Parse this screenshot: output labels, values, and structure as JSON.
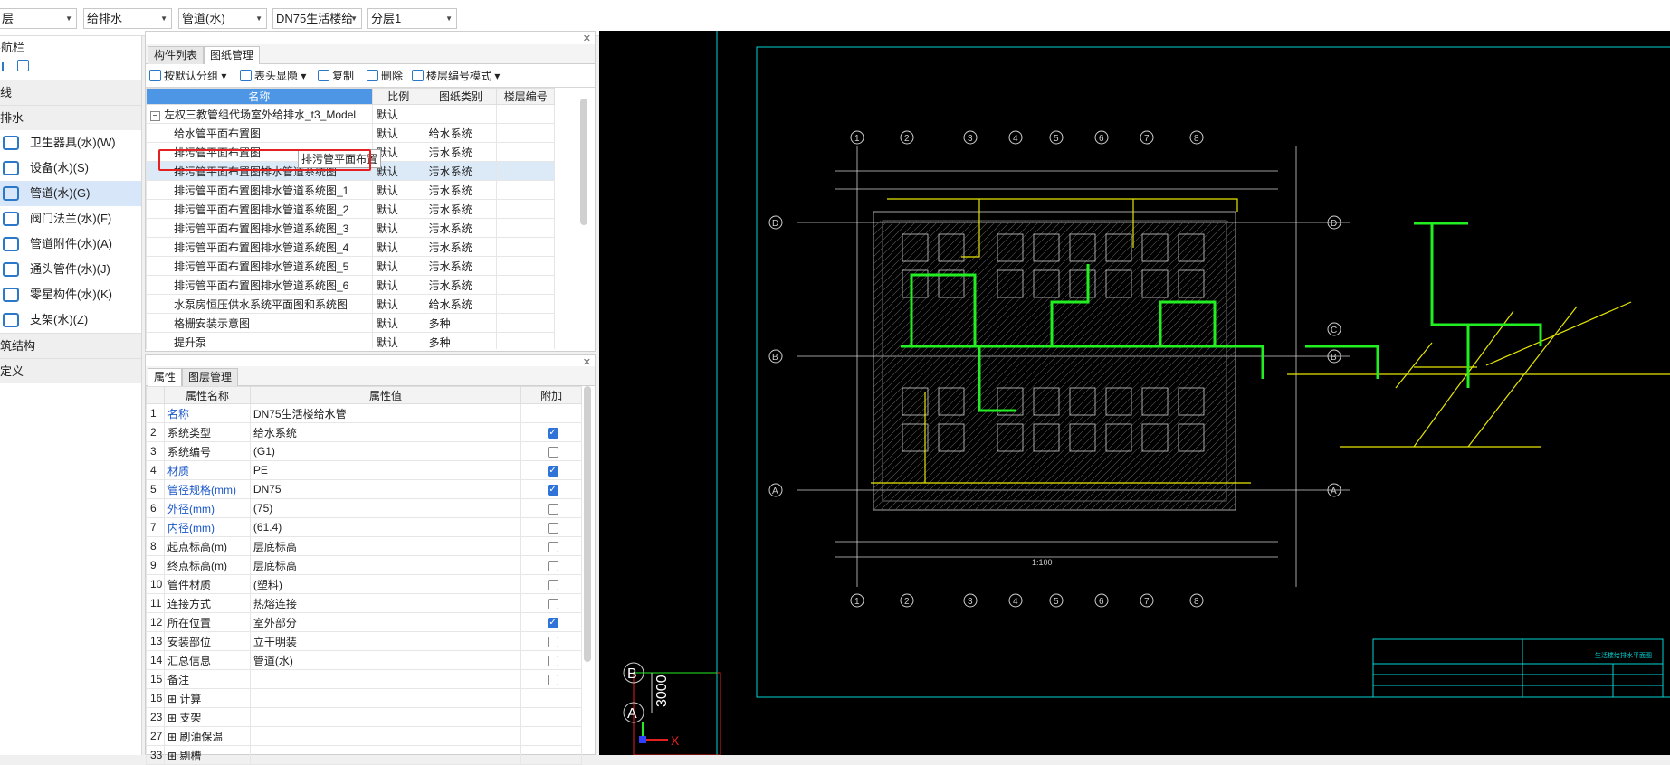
{
  "topbar": {
    "combos": [
      {
        "label": "层"
      },
      {
        "label": "给排水"
      },
      {
        "label": "管道(水)"
      },
      {
        "label": "DN75生活楼给"
      },
      {
        "label": "分层1"
      }
    ]
  },
  "nav": {
    "title": "导航栏",
    "categories": [
      {
        "label": "线"
      },
      {
        "label": "排水"
      }
    ],
    "items": [
      {
        "label": "卫生器具(水)(W)",
        "icon": "sanitary-icon"
      },
      {
        "label": "设备(水)(S)",
        "icon": "equipment-icon"
      },
      {
        "label": "管道(水)(G)",
        "icon": "pipe-icon"
      },
      {
        "label": "阀门法兰(水)(F)",
        "icon": "valve-icon"
      },
      {
        "label": "管道附件(水)(A)",
        "icon": "pipe-accessory-icon"
      },
      {
        "label": "通头管件(水)(J)",
        "icon": "fitting-icon"
      },
      {
        "label": "零星构件(水)(K)",
        "icon": "misc-component-icon"
      },
      {
        "label": "支架(水)(Z)",
        "icon": "support-icon"
      }
    ],
    "bottom_categories": [
      {
        "label": "筑结构"
      },
      {
        "label": "定义"
      }
    ]
  },
  "drawing_panel": {
    "tabs": [
      "构件列表",
      "图纸管理"
    ],
    "active_tab": "图纸管理",
    "toolbar": {
      "group": "按默认分组",
      "header_display": "表头显隐",
      "copy": "复制",
      "delete": "删除",
      "floor_mode": "楼层编号模式"
    },
    "columns": [
      "名称",
      "比例",
      "图纸类别",
      "楼层编号"
    ],
    "parent_row": {
      "name": "左权三教管组代场室外给排水_t3_Model",
      "scale": "默认"
    },
    "rows": [
      {
        "name": "给水管平面布置图",
        "scale": "默认",
        "category": "给水系统"
      },
      {
        "name": "排污管平面布置图",
        "scale": "默认",
        "category": "污水系统"
      },
      {
        "name": "排污管平面布置图排水管道系统图",
        "scale": "默认",
        "category": "污水系统"
      },
      {
        "name": "排污管平面布置图排水管道系统图_1",
        "scale": "默认",
        "category": "污水系统"
      },
      {
        "name": "排污管平面布置图排水管道系统图_2",
        "scale": "默认",
        "category": "污水系统"
      },
      {
        "name": "排污管平面布置图排水管道系统图_3",
        "scale": "默认",
        "category": "污水系统"
      },
      {
        "name": "排污管平面布置图排水管道系统图_4",
        "scale": "默认",
        "category": "污水系统"
      },
      {
        "name": "排污管平面布置图排水管道系统图_5",
        "scale": "默认",
        "category": "污水系统"
      },
      {
        "name": "排污管平面布置图排水管道系统图_6",
        "scale": "默认",
        "category": "污水系统"
      },
      {
        "name": "水泵房恒压供水系统平面图和系统图",
        "scale": "默认",
        "category": "给水系统"
      },
      {
        "name": "格栅安装示意图",
        "scale": "默认",
        "category": "多种"
      },
      {
        "name": "提升泵",
        "scale": "默认",
        "category": "多种"
      }
    ],
    "tooltip": "排污管平面布置"
  },
  "props_panel": {
    "tabs": [
      "属性",
      "图层管理"
    ],
    "active_tab": "属性",
    "columns": [
      "属性名称",
      "属性值",
      "附加"
    ],
    "rows": [
      {
        "num": "1",
        "name": "名称",
        "value": "DN75生活楼给水管",
        "blue": true,
        "check": "none"
      },
      {
        "num": "2",
        "name": "系统类型",
        "value": "给水系统",
        "blue": false,
        "check": "on"
      },
      {
        "num": "3",
        "name": "系统编号",
        "value": "(G1)",
        "blue": false,
        "check": "off"
      },
      {
        "num": "4",
        "name": "材质",
        "value": "PE",
        "blue": true,
        "check": "on"
      },
      {
        "num": "5",
        "name": "管径规格(mm)",
        "value": "DN75",
        "blue": true,
        "check": "on"
      },
      {
        "num": "6",
        "name": "外径(mm)",
        "value": "(75)",
        "blue": true,
        "check": "off"
      },
      {
        "num": "7",
        "name": "内径(mm)",
        "value": "(61.4)",
        "blue": true,
        "check": "off"
      },
      {
        "num": "8",
        "name": "起点标高(m)",
        "value": "层底标高",
        "blue": false,
        "check": "off"
      },
      {
        "num": "9",
        "name": "终点标高(m)",
        "value": "层底标高",
        "blue": false,
        "check": "off"
      },
      {
        "num": "10",
        "name": "管件材质",
        "value": "(塑料)",
        "blue": false,
        "check": "off"
      },
      {
        "num": "11",
        "name": "连接方式",
        "value": "热熔连接",
        "blue": false,
        "check": "off"
      },
      {
        "num": "12",
        "name": "所在位置",
        "value": "室外部分",
        "blue": false,
        "check": "on"
      },
      {
        "num": "13",
        "name": "安装部位",
        "value": "立干明装",
        "blue": false,
        "check": "off"
      },
      {
        "num": "14",
        "name": "汇总信息",
        "value": "管道(水)",
        "blue": false,
        "check": "off"
      },
      {
        "num": "15",
        "name": "备注",
        "value": "",
        "blue": false,
        "check": "off"
      },
      {
        "num": "16",
        "name": "⊞ 计算",
        "value": "",
        "blue": false,
        "check": "none"
      },
      {
        "num": "23",
        "name": "⊞ 支架",
        "value": "",
        "blue": false,
        "check": "none"
      },
      {
        "num": "27",
        "name": "⊞ 刷油保温",
        "value": "",
        "blue": false,
        "check": "none"
      },
      {
        "num": "33",
        "name": "⊞ 剔槽",
        "value": "",
        "blue": false,
        "check": "none"
      }
    ]
  },
  "cad": {
    "axis_b_label": "B",
    "axis_a_label": "A",
    "axis_x_label": "X",
    "dimension_text": "3000",
    "title_block_text": "生活楼给排水平面图",
    "scale_note": "1:100",
    "grid_top_labels": [
      "1",
      "2",
      "3",
      "4",
      "5",
      "6",
      "7",
      "8"
    ],
    "grid_side_labels": [
      "D",
      "B",
      "A"
    ],
    "grid_right_labels": [
      "D",
      "C",
      "B",
      "A"
    ]
  },
  "colors": {
    "selected_tab_header": "#4d96e6",
    "red_highlight": "#e52020",
    "cad_background": "#000000",
    "cad_cyan": "#00d5d5",
    "cad_green": "#22ee22",
    "cad_yellow": "#e6e600"
  }
}
